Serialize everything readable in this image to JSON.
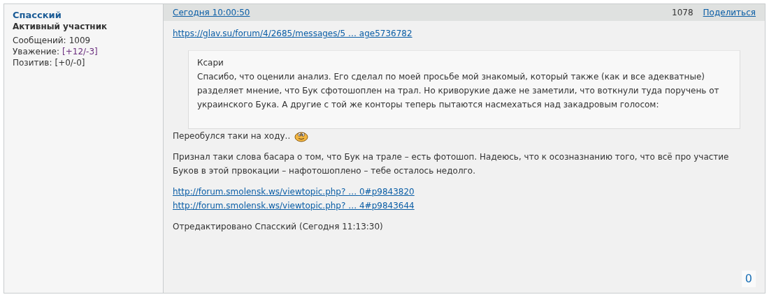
{
  "author": {
    "name": "Спасский",
    "rank": "Активный участник",
    "stats": [
      {
        "label": "Сообщений:",
        "value": "1009",
        "kind": "text"
      },
      {
        "label": "Уважение:",
        "value": "[+12/-3]",
        "kind": "link"
      },
      {
        "label": "Позитив:",
        "value": "[+0/-0]",
        "kind": "text"
      }
    ]
  },
  "post": {
    "date": "Сегодня 10:00:50",
    "number": "1078",
    "share": "Поделиться",
    "link": "https://glav.su/forum/4/2685/messages/5 … age5736782",
    "quote": {
      "author": "Ксари",
      "text": "Спасибо, что оценили анализ. Его сделал по моей просьбе мой знакомый, который также (как и все адекватные) разделяет мнение, что Бук сфотошоплен на трал. Но криворукие даже не заметили, что воткнули туда поручень от украинского Бука. А другие с той же конторы теперь пытаются насмехаться над закадровым голосом:"
    },
    "line": "Переобулся таки на ходу..",
    "paragraph": "Признал таки  слова басара о том, что Бук на трале – есть фотошоп. Надеюсь, что к осозназнанию того, что всё про участие Буков в этой првокации – нафотошоплено – тебе осталось недолго.",
    "links": [
      "http://forum.smolensk.ws/viewtopic.php? … 0#p9843820",
      "http://forum.smolensk.ws/viewtopic.php? … 4#p9843644"
    ],
    "edited": "Отредактировано Спасский (Сегодня 11:13:30)",
    "votes": "0"
  }
}
